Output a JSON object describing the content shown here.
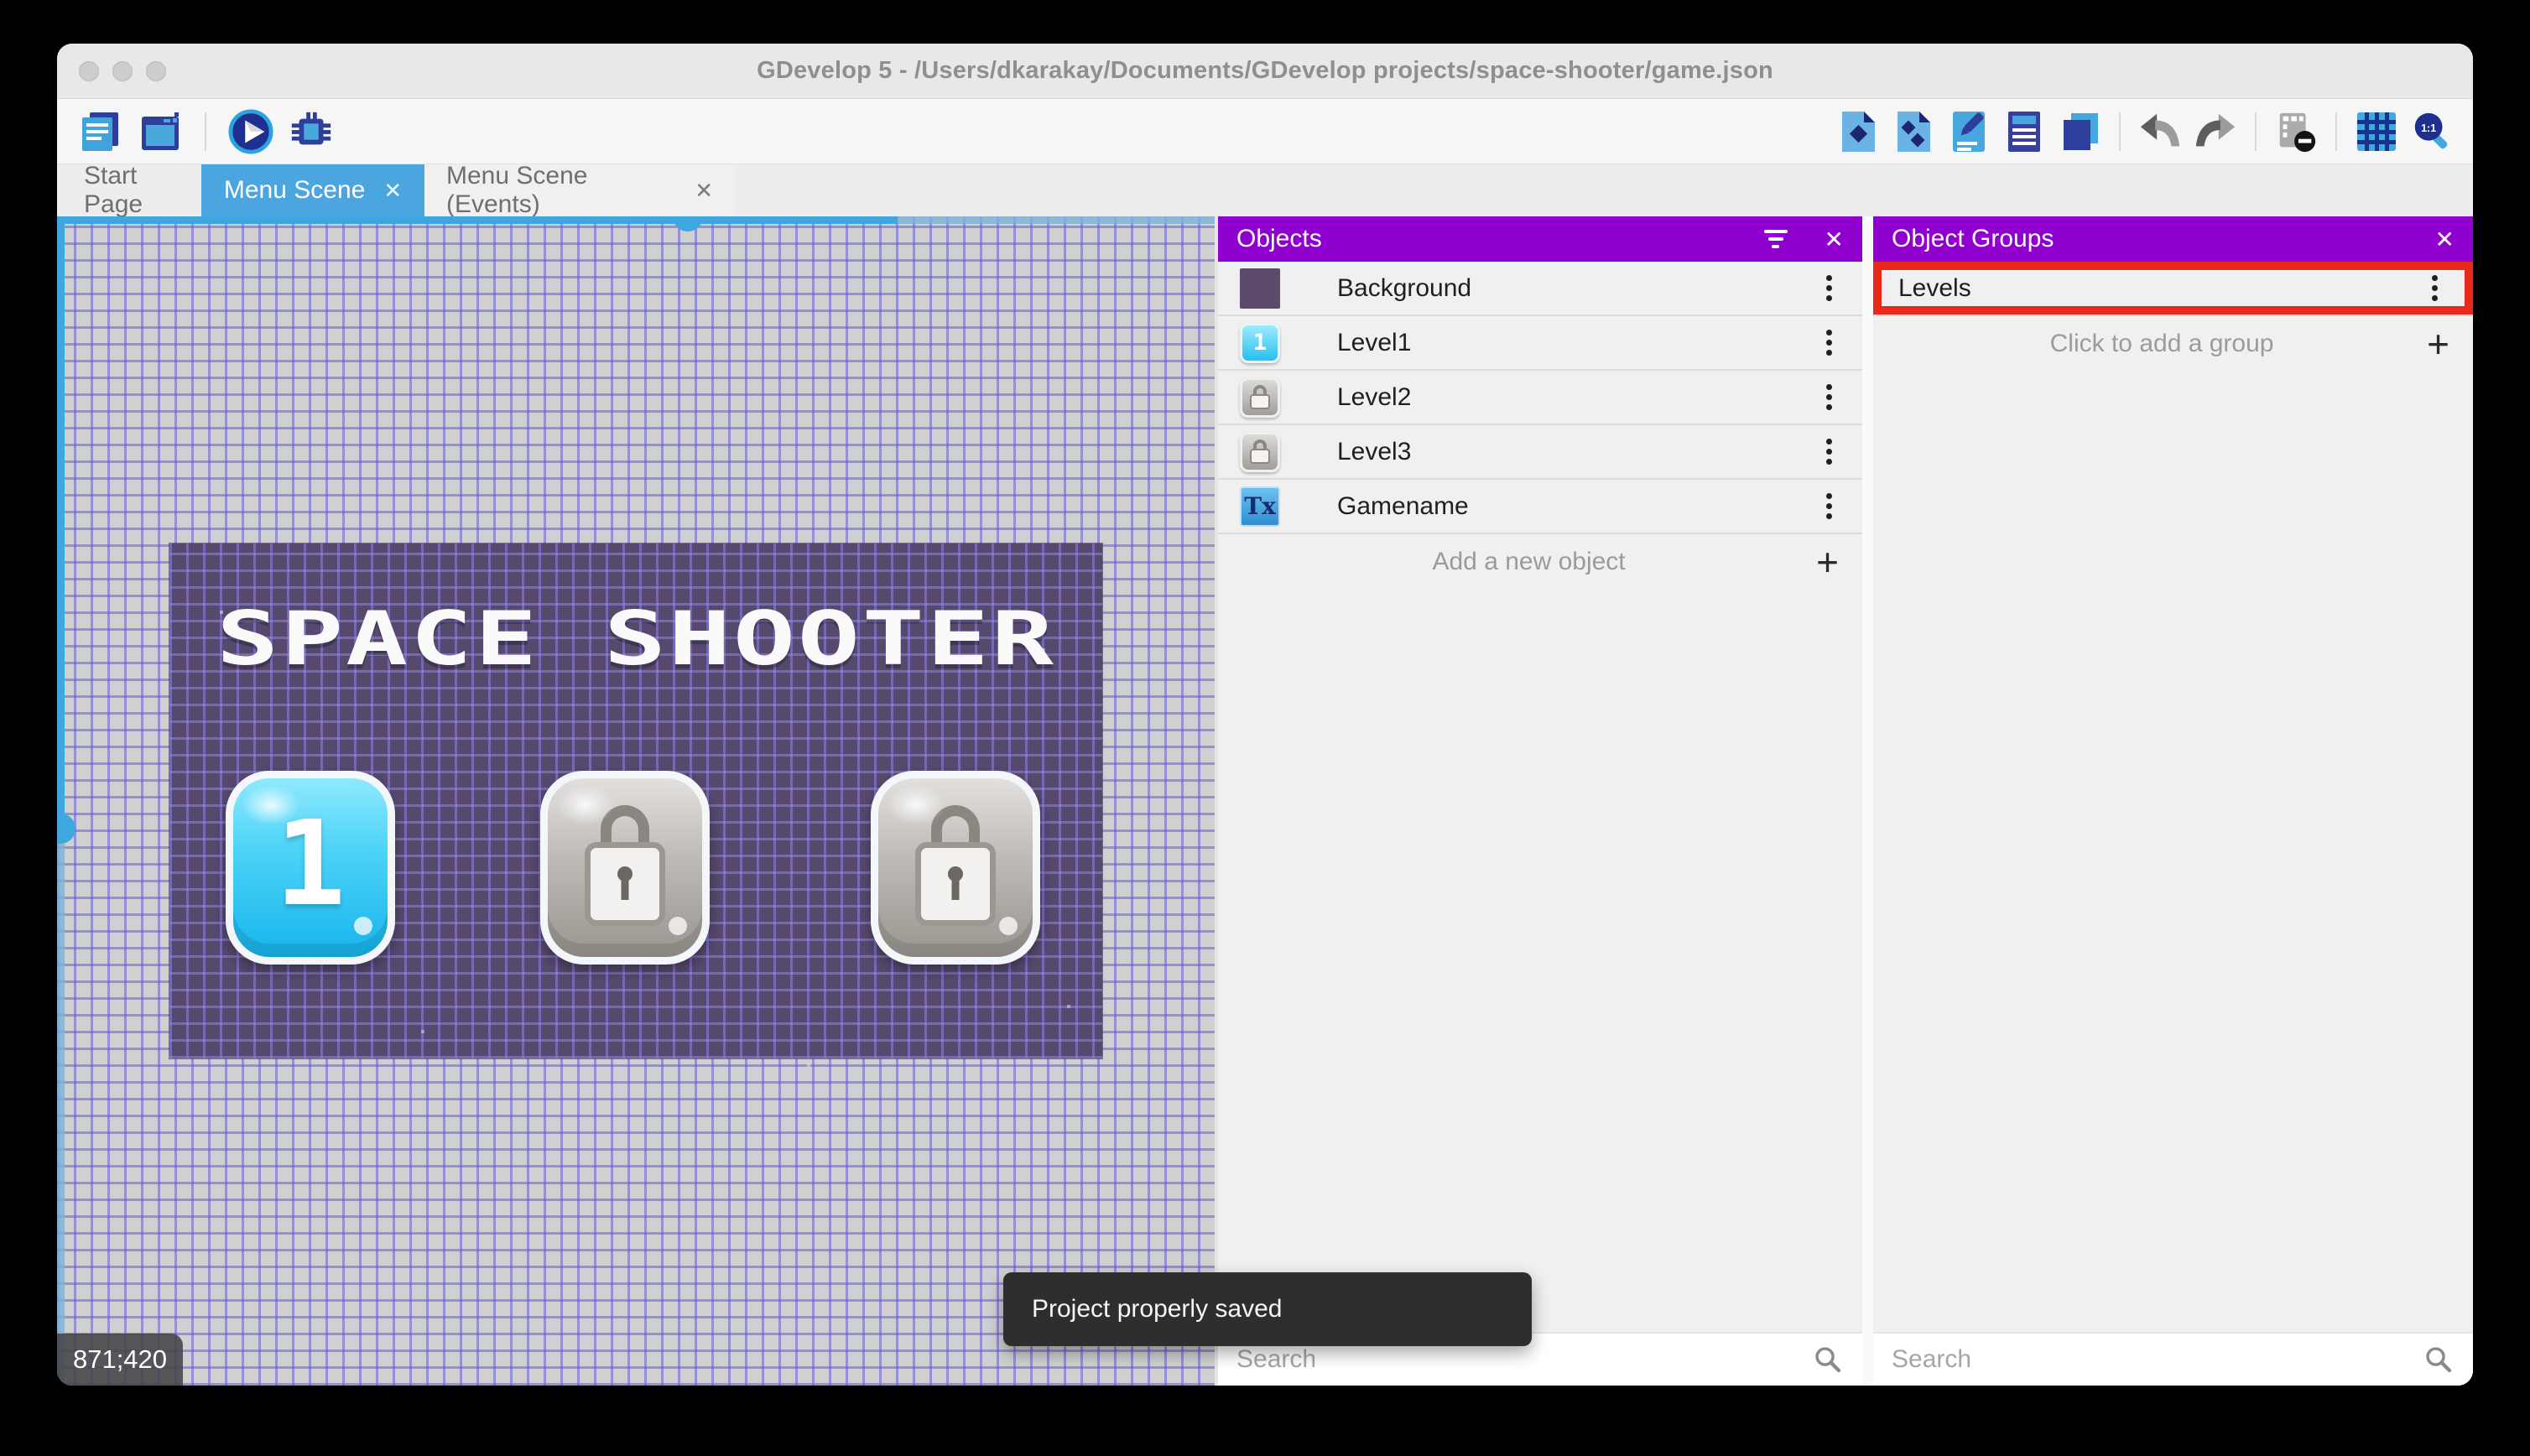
{
  "window": {
    "title": "GDevelop 5 - /Users/dkarakay/Documents/GDevelop projects/space-shooter/game.json"
  },
  "tabs": [
    {
      "label": "Start Page",
      "active": false,
      "closable": false,
      "close_glyph": ""
    },
    {
      "label": "Menu Scene",
      "active": true,
      "closable": true,
      "close_glyph": "✕"
    },
    {
      "label": "Menu Scene (Events)",
      "active": false,
      "closable": true,
      "close_glyph": "✕"
    }
  ],
  "toolbar": {
    "left_icons": [
      "project-manager",
      "scene-window",
      "play-preview",
      "debug"
    ],
    "right_icons": [
      "objects-editor",
      "object-groups-editor",
      "properties",
      "instances-list",
      "layers",
      "undo",
      "redo",
      "hide-instances",
      "grid",
      "zoom-1-1"
    ],
    "zoom_label": "1:1"
  },
  "scene_canvas": {
    "scene_title": "SPACE SHOOTER",
    "coordinates": "871;420",
    "level_buttons": [
      {
        "state": "unlocked",
        "label": "1"
      },
      {
        "state": "locked",
        "label": ""
      },
      {
        "state": "locked",
        "label": ""
      }
    ]
  },
  "objects_panel": {
    "title": "Objects",
    "close_glyph": "✕",
    "items": [
      {
        "name": "Background",
        "thumb": "color-swatch"
      },
      {
        "name": "Level1",
        "thumb": "blue-button-1"
      },
      {
        "name": "Level2",
        "thumb": "locked-button"
      },
      {
        "name": "Level3",
        "thumb": "locked-button"
      },
      {
        "name": "Gamename",
        "thumb": "text-object"
      }
    ],
    "add_label": "Add a new object",
    "add_glyph": "+",
    "search_placeholder": "Search"
  },
  "groups_panel": {
    "title": "Object Groups",
    "close_glyph": "✕",
    "items": [
      {
        "name": "Levels",
        "highlighted": true
      }
    ],
    "add_label": "Click to add a group",
    "add_glyph": "+",
    "search_placeholder": "Search"
  },
  "toast": {
    "message": "Project properly saved"
  },
  "colors": {
    "accent_blue": "#4BA5DF",
    "panel_purple": "#9000CE",
    "highlight_red": "#E8291C",
    "scene_purple": "#57486E",
    "canvas_gray": "#D0D0D0",
    "toast_bg": "#2E2E2E"
  }
}
